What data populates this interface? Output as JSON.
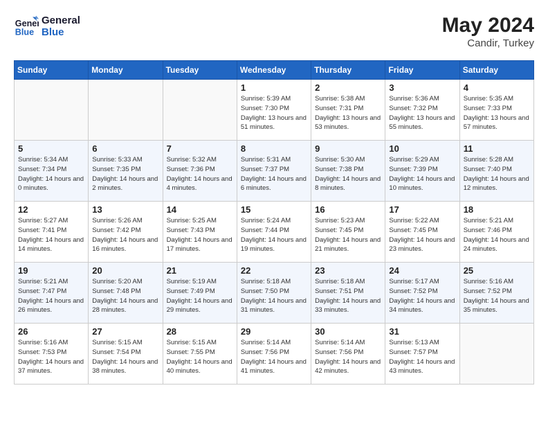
{
  "header": {
    "logo_line1": "General",
    "logo_line2": "Blue",
    "month_year": "May 2024",
    "location": "Candir, Turkey"
  },
  "weekdays": [
    "Sunday",
    "Monday",
    "Tuesday",
    "Wednesday",
    "Thursday",
    "Friday",
    "Saturday"
  ],
  "weeks": [
    [
      {
        "day": "",
        "empty": true
      },
      {
        "day": "",
        "empty": true
      },
      {
        "day": "",
        "empty": true
      },
      {
        "day": "1",
        "sunrise": "5:39 AM",
        "sunset": "7:30 PM",
        "daylight": "13 hours and 51 minutes."
      },
      {
        "day": "2",
        "sunrise": "5:38 AM",
        "sunset": "7:31 PM",
        "daylight": "13 hours and 53 minutes."
      },
      {
        "day": "3",
        "sunrise": "5:36 AM",
        "sunset": "7:32 PM",
        "daylight": "13 hours and 55 minutes."
      },
      {
        "day": "4",
        "sunrise": "5:35 AM",
        "sunset": "7:33 PM",
        "daylight": "13 hours and 57 minutes."
      }
    ],
    [
      {
        "day": "5",
        "sunrise": "5:34 AM",
        "sunset": "7:34 PM",
        "daylight": "14 hours and 0 minutes."
      },
      {
        "day": "6",
        "sunrise": "5:33 AM",
        "sunset": "7:35 PM",
        "daylight": "14 hours and 2 minutes."
      },
      {
        "day": "7",
        "sunrise": "5:32 AM",
        "sunset": "7:36 PM",
        "daylight": "14 hours and 4 minutes."
      },
      {
        "day": "8",
        "sunrise": "5:31 AM",
        "sunset": "7:37 PM",
        "daylight": "14 hours and 6 minutes."
      },
      {
        "day": "9",
        "sunrise": "5:30 AM",
        "sunset": "7:38 PM",
        "daylight": "14 hours and 8 minutes."
      },
      {
        "day": "10",
        "sunrise": "5:29 AM",
        "sunset": "7:39 PM",
        "daylight": "14 hours and 10 minutes."
      },
      {
        "day": "11",
        "sunrise": "5:28 AM",
        "sunset": "7:40 PM",
        "daylight": "14 hours and 12 minutes."
      }
    ],
    [
      {
        "day": "12",
        "sunrise": "5:27 AM",
        "sunset": "7:41 PM",
        "daylight": "14 hours and 14 minutes."
      },
      {
        "day": "13",
        "sunrise": "5:26 AM",
        "sunset": "7:42 PM",
        "daylight": "14 hours and 16 minutes."
      },
      {
        "day": "14",
        "sunrise": "5:25 AM",
        "sunset": "7:43 PM",
        "daylight": "14 hours and 17 minutes."
      },
      {
        "day": "15",
        "sunrise": "5:24 AM",
        "sunset": "7:44 PM",
        "daylight": "14 hours and 19 minutes."
      },
      {
        "day": "16",
        "sunrise": "5:23 AM",
        "sunset": "7:45 PM",
        "daylight": "14 hours and 21 minutes."
      },
      {
        "day": "17",
        "sunrise": "5:22 AM",
        "sunset": "7:45 PM",
        "daylight": "14 hours and 23 minutes."
      },
      {
        "day": "18",
        "sunrise": "5:21 AM",
        "sunset": "7:46 PM",
        "daylight": "14 hours and 24 minutes."
      }
    ],
    [
      {
        "day": "19",
        "sunrise": "5:21 AM",
        "sunset": "7:47 PM",
        "daylight": "14 hours and 26 minutes."
      },
      {
        "day": "20",
        "sunrise": "5:20 AM",
        "sunset": "7:48 PM",
        "daylight": "14 hours and 28 minutes."
      },
      {
        "day": "21",
        "sunrise": "5:19 AM",
        "sunset": "7:49 PM",
        "daylight": "14 hours and 29 minutes."
      },
      {
        "day": "22",
        "sunrise": "5:18 AM",
        "sunset": "7:50 PM",
        "daylight": "14 hours and 31 minutes."
      },
      {
        "day": "23",
        "sunrise": "5:18 AM",
        "sunset": "7:51 PM",
        "daylight": "14 hours and 33 minutes."
      },
      {
        "day": "24",
        "sunrise": "5:17 AM",
        "sunset": "7:52 PM",
        "daylight": "14 hours and 34 minutes."
      },
      {
        "day": "25",
        "sunrise": "5:16 AM",
        "sunset": "7:52 PM",
        "daylight": "14 hours and 35 minutes."
      }
    ],
    [
      {
        "day": "26",
        "sunrise": "5:16 AM",
        "sunset": "7:53 PM",
        "daylight": "14 hours and 37 minutes."
      },
      {
        "day": "27",
        "sunrise": "5:15 AM",
        "sunset": "7:54 PM",
        "daylight": "14 hours and 38 minutes."
      },
      {
        "day": "28",
        "sunrise": "5:15 AM",
        "sunset": "7:55 PM",
        "daylight": "14 hours and 40 minutes."
      },
      {
        "day": "29",
        "sunrise": "5:14 AM",
        "sunset": "7:56 PM",
        "daylight": "14 hours and 41 minutes."
      },
      {
        "day": "30",
        "sunrise": "5:14 AM",
        "sunset": "7:56 PM",
        "daylight": "14 hours and 42 minutes."
      },
      {
        "day": "31",
        "sunrise": "5:13 AM",
        "sunset": "7:57 PM",
        "daylight": "14 hours and 43 minutes."
      },
      {
        "day": "",
        "empty": true
      }
    ]
  ]
}
